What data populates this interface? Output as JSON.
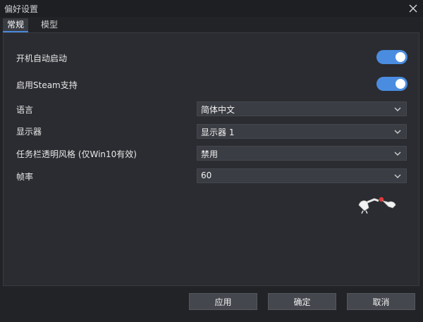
{
  "window": {
    "title": "偏好设置"
  },
  "tabs": [
    {
      "label": "常规",
      "active": true
    },
    {
      "label": "模型",
      "active": false
    }
  ],
  "settings": {
    "autostart": {
      "label": "开机自动启动",
      "on": true
    },
    "steam": {
      "label": "启用Steam支持",
      "on": true
    },
    "language": {
      "label": "语言",
      "value": "简体中文"
    },
    "monitor": {
      "label": "显示器",
      "value": "显示器 1"
    },
    "taskbar": {
      "label": "任务栏透明风格 (仅Win10有效)",
      "value": "禁用"
    },
    "framerate": {
      "label": "帧率",
      "value": "60"
    }
  },
  "footer": {
    "apply_label": "应用",
    "ok_label": "确定",
    "cancel_label": "取消"
  },
  "colors": {
    "accent": "#4a8de0",
    "background": "#2b2c31",
    "dropdown": "#3b3d44",
    "button": "#45474e"
  },
  "icons": [
    "close-icon",
    "chevron-down-icon",
    "mascot-sticker"
  ]
}
